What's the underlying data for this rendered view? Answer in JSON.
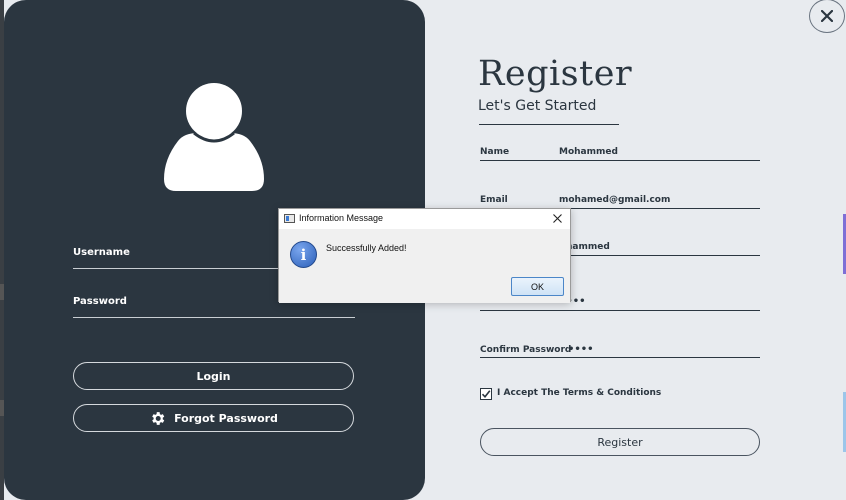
{
  "left_panel": {
    "username_label": "Username",
    "password_label": "Password",
    "login_label": "Login",
    "forgot_label": "Forgot Password"
  },
  "right_panel": {
    "title": "Register",
    "subtitle": "Let's Get Started",
    "fields": [
      {
        "label": "Name",
        "value": "Mohammed"
      },
      {
        "label": "Email",
        "value": "mohamed@gmail.com"
      },
      {
        "label": "",
        "value": "hammed"
      },
      {
        "label": "",
        "value": "••••"
      },
      {
        "label": "Confirm Password",
        "value": "••••"
      }
    ],
    "terms_label": "I Accept The Terms & Conditions",
    "terms_checked": true,
    "register_label": "Register",
    "close_icon": "close-icon"
  },
  "dialog": {
    "title": "Information Message",
    "message": "Successfully Added!",
    "ok_label": "OK",
    "icon": "info-icon"
  },
  "colors": {
    "dark_panel": "#2b3640",
    "light_panel": "#e8ebef",
    "accent_blue": "#2b5fb8"
  }
}
